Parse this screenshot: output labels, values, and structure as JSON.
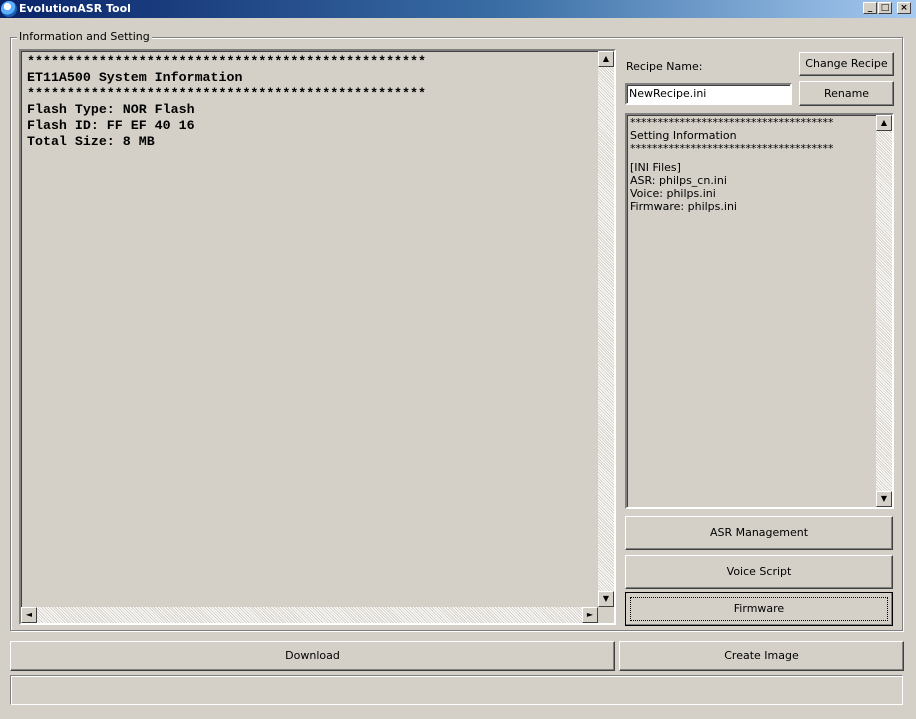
{
  "window": {
    "title": "EvolutionASR Tool",
    "controls": {
      "minimize": "_",
      "maximize": "□",
      "close": "×"
    }
  },
  "group": {
    "label": "Information and Setting"
  },
  "info_log": {
    "lines": [
      "**************************************************",
      "ET11A500 System Information",
      "**************************************************",
      "Flash Type: NOR Flash",
      "Flash ID: FF EF 40 16",
      "Total Size: 8 MB"
    ]
  },
  "recipe": {
    "label": "Recipe Name:",
    "value": "NewRecipe.ini",
    "change_button": "Change Recipe",
    "rename_button": "Rename"
  },
  "settings": {
    "lines": [
      "*************************************",
      "Setting Information",
      "*************************************",
      "",
      "[INI Files]",
      "ASR: philps_cn.ini",
      "Voice: philps.ini",
      "Firmware: philps.ini"
    ]
  },
  "actions": {
    "asr_management": "ASR Management",
    "voice_script": "Voice Script",
    "firmware": "Firmware",
    "download": "Download",
    "create_image": "Create Image"
  },
  "status": {
    "text": ""
  },
  "icons": {
    "scroll_up": "▲",
    "scroll_down": "▼",
    "scroll_left": "◄",
    "scroll_right": "►"
  }
}
